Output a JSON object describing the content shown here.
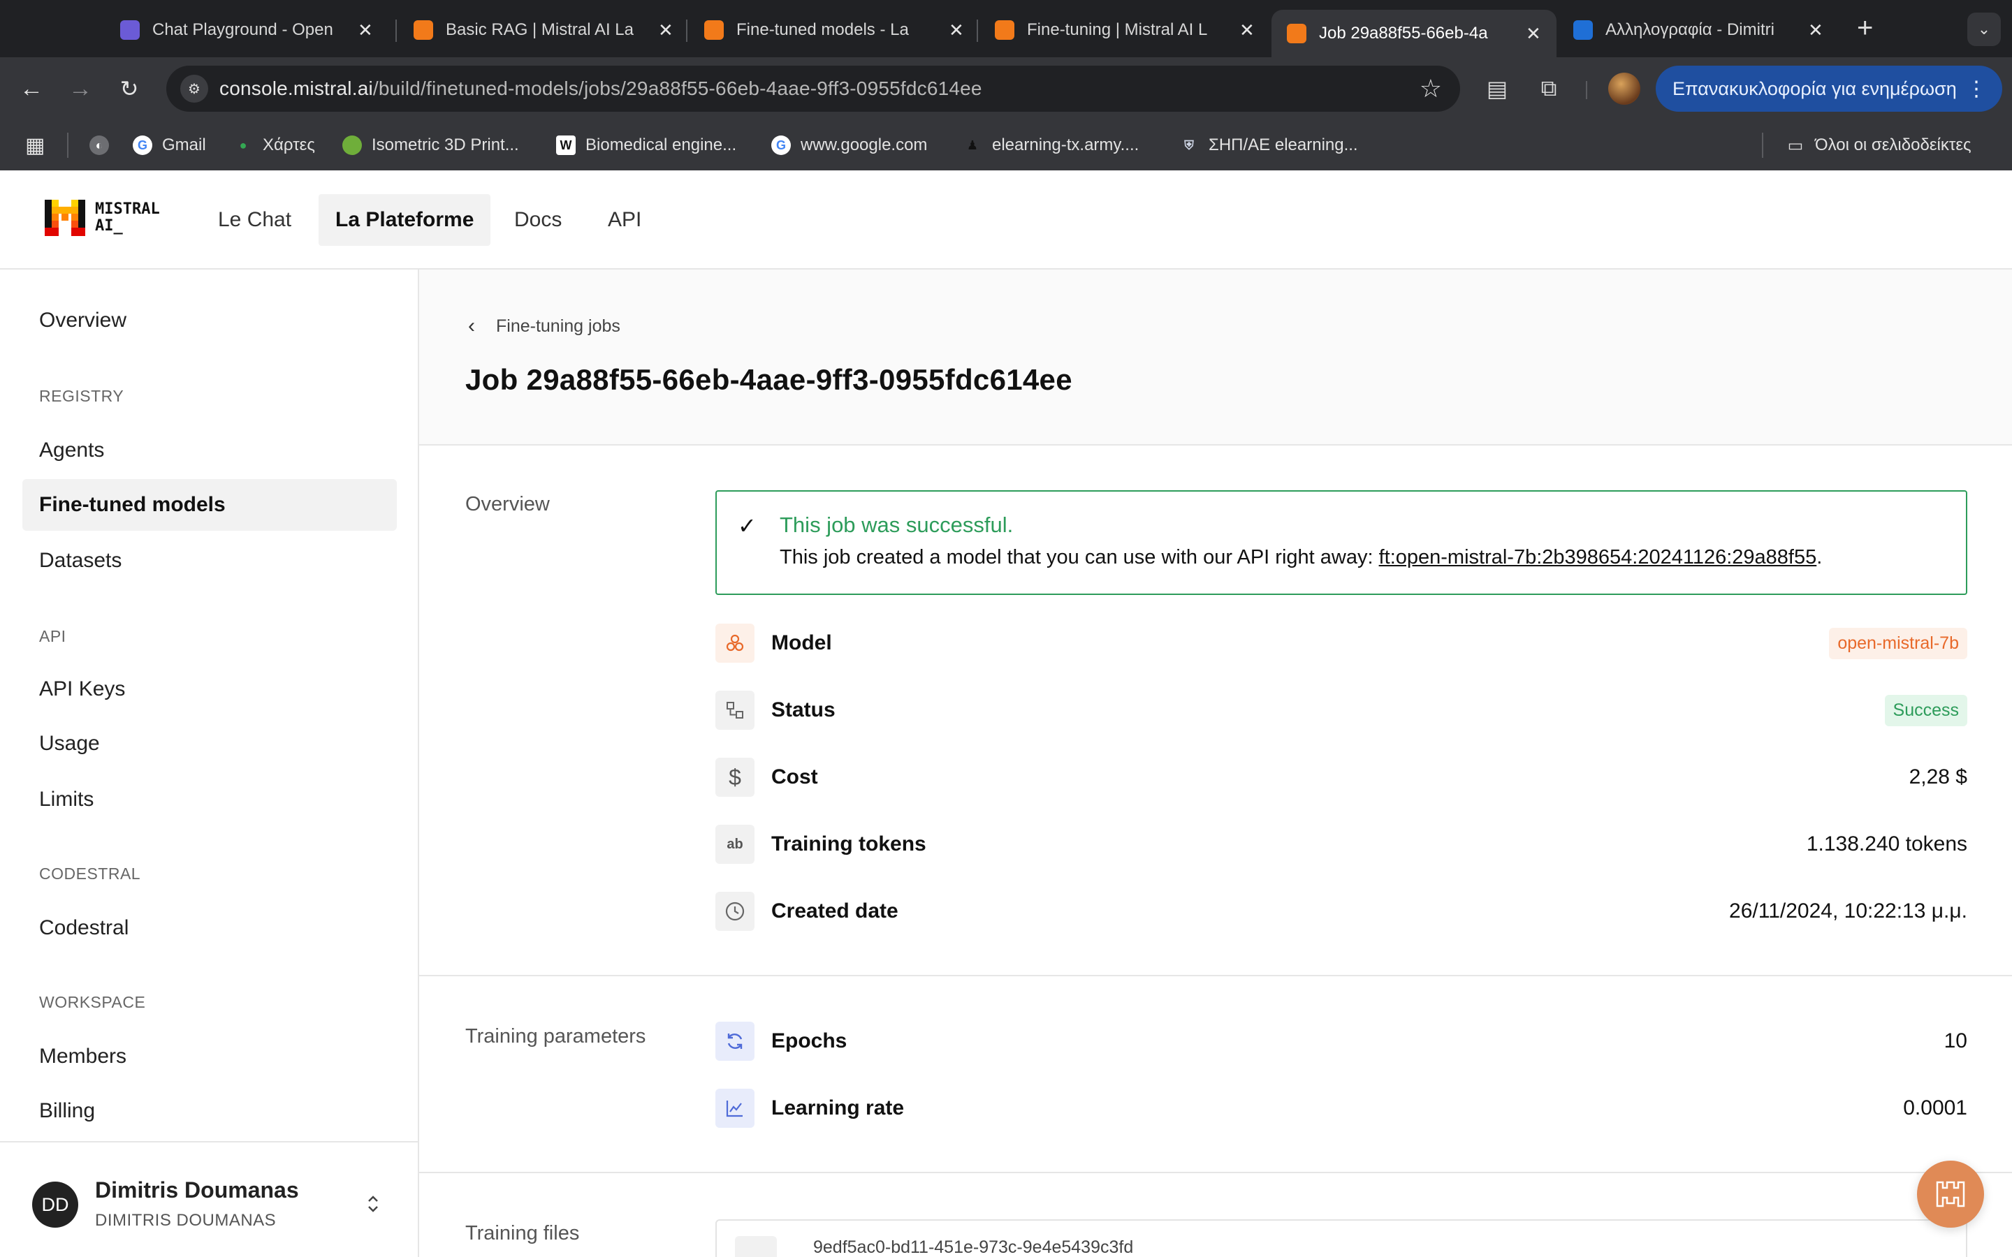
{
  "browser": {
    "tabs": [
      {
        "title": "Chat Playground - Open",
        "close": "✕"
      },
      {
        "title": "Basic RAG | Mistral AI La",
        "close": "✕"
      },
      {
        "title": "Fine-tuned models - La",
        "close": "✕"
      },
      {
        "title": "Fine-tuning | Mistral AI L",
        "close": "✕"
      },
      {
        "title": "Job 29a88f55-66eb-4a",
        "close": "✕"
      },
      {
        "title": "Αλληλογραφία - Dimitri",
        "close": "✕"
      }
    ],
    "new_tab": "+",
    "tab_menu": "⌄",
    "url_host": "console.mistral.ai",
    "url_path": "/build/finetuned-models/jobs/29a88f55-66eb-4aae-9ff3-0955fdc614ee",
    "relaunch_label": "Επανακυκλοφορία για ενημέρωση",
    "relaunch_dots": "⋮",
    "bookmarks": [
      {
        "label": "Gmail"
      },
      {
        "label": "Χάρτες"
      },
      {
        "label": "Isometric 3D Print..."
      },
      {
        "label": "Biomedical engine..."
      },
      {
        "label": "www.google.com"
      },
      {
        "label": "elearning-tx.army...."
      },
      {
        "label": "ΣΗΠ/ΑΕ elearning..."
      }
    ],
    "all_bookmarks": "Όλοι οι σελιδοδείκτες"
  },
  "header": {
    "logo_line1": "MISTRAL",
    "logo_line2": "AI_",
    "nav": [
      "Le Chat",
      "La Plateforme",
      "Docs",
      "API"
    ]
  },
  "sidebar": {
    "overview": "Overview",
    "registry_title": "REGISTRY",
    "registry": [
      "Agents",
      "Fine-tuned models",
      "Datasets"
    ],
    "api_title": "API",
    "api": [
      "API Keys",
      "Usage",
      "Limits"
    ],
    "codestral_title": "CODESTRAL",
    "codestral": [
      "Codestral"
    ],
    "workspace_title": "WORKSPACE",
    "workspace": [
      "Members",
      "Billing"
    ],
    "user": {
      "initials": "DD",
      "name": "Dimitris Doumanas",
      "org": "DIMITRIS DOUMANAS",
      "toggle": "⌃⌄"
    }
  },
  "page": {
    "breadcrumb": "Fine-tuning jobs",
    "title": "Job 29a88f55-66eb-4aae-9ff3-0955fdc614ee",
    "overview_label": "Overview",
    "success_title": "This job was successful.",
    "success_text": "This job created a model that you can use with our API right away: ",
    "model_link": "ft:open-mistral-7b:2b398654:20241126:29a88f55",
    "success_end": ".",
    "rows": {
      "model_label": "Model",
      "model_value": "open-mistral-7b",
      "status_label": "Status",
      "status_value": "Success",
      "cost_label": "Cost",
      "cost_value": "2,28 $",
      "tokens_label": "Training tokens",
      "tokens_value": "1.138.240 tokens",
      "date_label": "Created date",
      "date_value": "26/11/2024, 10:22:13 μ.μ."
    },
    "params_label": "Training parameters",
    "params": {
      "epochs_label": "Epochs",
      "epochs_value": "10",
      "lr_label": "Learning rate",
      "lr_value": "0.0001"
    },
    "files_label": "Training files",
    "file_id": "9edf5ac0-bd11-451e-973c-9e4e5439c3fd"
  },
  "colors": {
    "success_green": "#2d9c5a",
    "accent_orange": "#e8692a",
    "param_blue": "#4f6bd8"
  }
}
